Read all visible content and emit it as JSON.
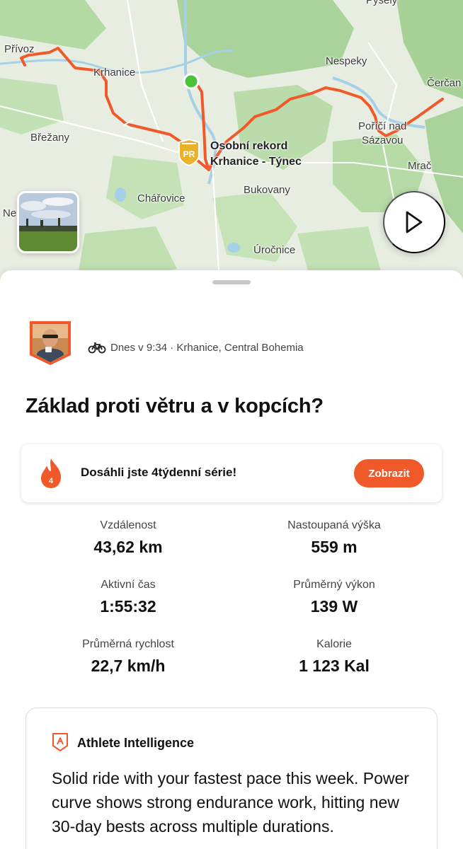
{
  "map": {
    "labels": {
      "privoz": "Přívoz",
      "krhanice": "Krhanice",
      "nespeky": "Nespeky",
      "cercany": "Čerčan",
      "brezany": "Břežany",
      "porici_1": "Poříčí nad",
      "porici_2": "Sázavou",
      "pr_1": "Osobní rekord",
      "pr_2": "Krhanice - Týnec",
      "mrac": "Mrač",
      "bukovany": "Bukovany",
      "charovice": "Chářovice",
      "ne": "Ne",
      "urocnice": "Úročnice",
      "pysely": "Pyšely"
    },
    "pr_badge_text": "PR",
    "route_color": "#f0592a",
    "start_color": "#4cc13c"
  },
  "activity": {
    "meta": "Dnes v 9:34 · Krhanice, Central Bohemia",
    "title": "Základ proti větru a v kopcích?"
  },
  "streak": {
    "count": "4",
    "message": "Dosáhli jste 4týdenní série!",
    "button": "Zobrazit"
  },
  "stats": [
    {
      "label": "Vzdálenost",
      "value": "43,62 km"
    },
    {
      "label": "Nastoupaná výška",
      "value": "559 m"
    },
    {
      "label": "Aktivní čas",
      "value": "1:55:32"
    },
    {
      "label": "Průměrný výkon",
      "value": "139 W"
    },
    {
      "label": "Průměrná rychlost",
      "value": "22,7 km/h"
    },
    {
      "label": "Kalorie",
      "value": "1 123 Kal"
    }
  ],
  "ai": {
    "title": "Athlete Intelligence",
    "text": "Solid ride with your fastest pace this week. Power curve shows strong endurance work, hitting new 30-day bests across multiple durations."
  },
  "colors": {
    "accent": "#f0592a"
  }
}
